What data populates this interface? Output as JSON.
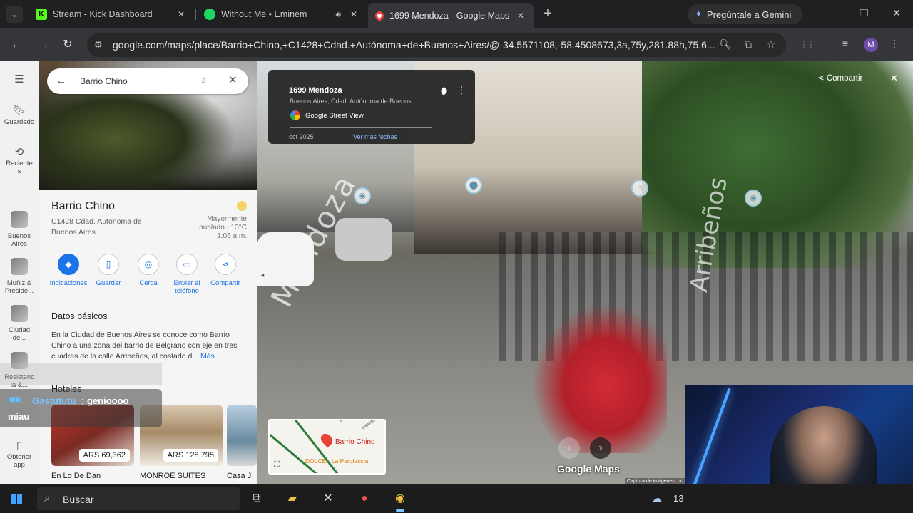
{
  "browser": {
    "tabs": [
      {
        "title": "Stream - Kick Dashboard",
        "favicon": "K"
      },
      {
        "title": "Without Me • Eminem",
        "favicon": "spotify"
      },
      {
        "title": "1699 Mendoza - Google Maps",
        "favicon": "maps"
      }
    ],
    "gemini_label": "Pregúntale a Gemini",
    "url": "google.com/maps/place/Barrio+Chino,+C1428+Cdad.+Autónoma+de+Buenos+Aires/@-34.5571108,-58.4508673,3a,75y,281.88h,75.6...",
    "profile_initial": "M"
  },
  "rail": {
    "saved": "Guardado",
    "recent": "Reciente s",
    "recent_places": [
      {
        "label": "Buenos Aires"
      },
      {
        "label": "Muñiz & Preside..."
      },
      {
        "label": "Ciudad de..."
      },
      {
        "label": "Resistenc ia &..."
      }
    ],
    "get_app": "Obtener app"
  },
  "search": {
    "value": "Barrio Chino"
  },
  "place": {
    "name": "Barrio Chino",
    "address": "C1428 Cdad. Autónoma de Buenos Aires",
    "weather_text": "Mayormente nublado · 13°C",
    "weather_time": "1:06 a.m.",
    "actions": [
      {
        "label": "Indicaciones",
        "icon": "directions-icon"
      },
      {
        "label": "Guardar",
        "icon": "bookmark-icon"
      },
      {
        "label": "Cerca",
        "icon": "nearby-icon"
      },
      {
        "label": "Enviar al teléfono",
        "icon": "send-to-phone-icon"
      },
      {
        "label": "Compartir",
        "icon": "share-icon"
      }
    ],
    "basics_title": "Datos básicos",
    "basics_text": "En la Ciudad de Buenos Aires se conoce como Barrio Chino a una zona del barrio de Belgrano con eje en tres cuadras de la calle Arribeños, al costado d...",
    "basics_more": "Más",
    "hotels_title": "Hoteles",
    "hotels": [
      {
        "name": "En Lo De Dan",
        "price": "ARS 69,362"
      },
      {
        "name": "MONROE SUITES",
        "price": "ARS 128,795"
      },
      {
        "name": "Casa J",
        "price": ""
      }
    ]
  },
  "chat": {
    "user": "Gastututu",
    "message_line1": "genioooo",
    "message_line2": "miau"
  },
  "streetview": {
    "card_address": "1699 Mendoza",
    "card_sub": "Buenos Aires, Cdad. Autónoma de Buenos ...",
    "card_source": "Google Street View",
    "card_date": "oct 2025",
    "card_more_dates": "Ver más fechas",
    "share": "Compartir",
    "street_label_1": "Mendoza",
    "street_label_2": "Arribeños",
    "minimap_label": "Barrio Chino",
    "minimap_label2": "DOLCE - La Parolaccia",
    "minimap_label3": "Mendo",
    "logo": "Google Maps",
    "capture": "Captura de imágenes: oc"
  },
  "taskbar": {
    "search_text": "Buscar",
    "temperature": "13"
  }
}
